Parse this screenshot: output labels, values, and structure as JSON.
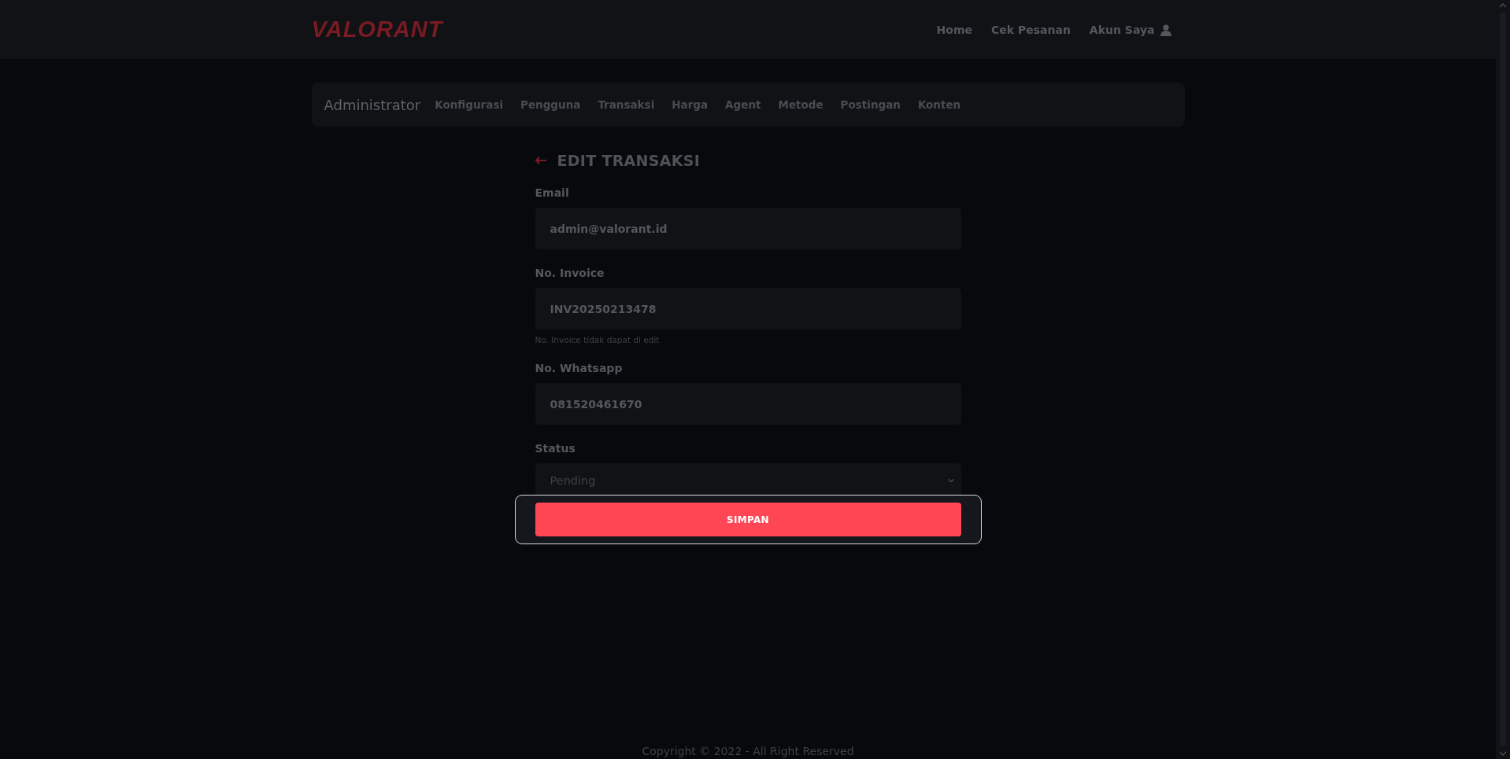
{
  "header": {
    "brand": "VALORANT",
    "nav": [
      {
        "label": "Home"
      },
      {
        "label": "Cek Pesanan"
      },
      {
        "label": "Akun Saya",
        "kind": "account"
      }
    ]
  },
  "admin_bar": {
    "title": "Administrator",
    "items": [
      "Konfigurasi",
      "Pengguna",
      "Transaksi",
      "Harga",
      "Agent",
      "Metode",
      "Postingan",
      "Konten"
    ]
  },
  "form": {
    "title": "EDIT TRANSAKSI",
    "fields": [
      {
        "kind": "input",
        "label": "Email",
        "value": "admin@valorant.id"
      },
      {
        "kind": "input",
        "label": "No. Invoice",
        "value": "INV20250213478",
        "help": "No. Invoice tidak dapat di edit"
      },
      {
        "kind": "input",
        "label": "No. Whatsapp",
        "value": "081520461670"
      },
      {
        "kind": "select",
        "label": "Status",
        "value": "Pending"
      }
    ],
    "submit": {
      "label": "SIMPAN",
      "focused": true
    }
  },
  "footer": {
    "copyright": "Copyright © 2022 - All Right Reserved"
  }
}
